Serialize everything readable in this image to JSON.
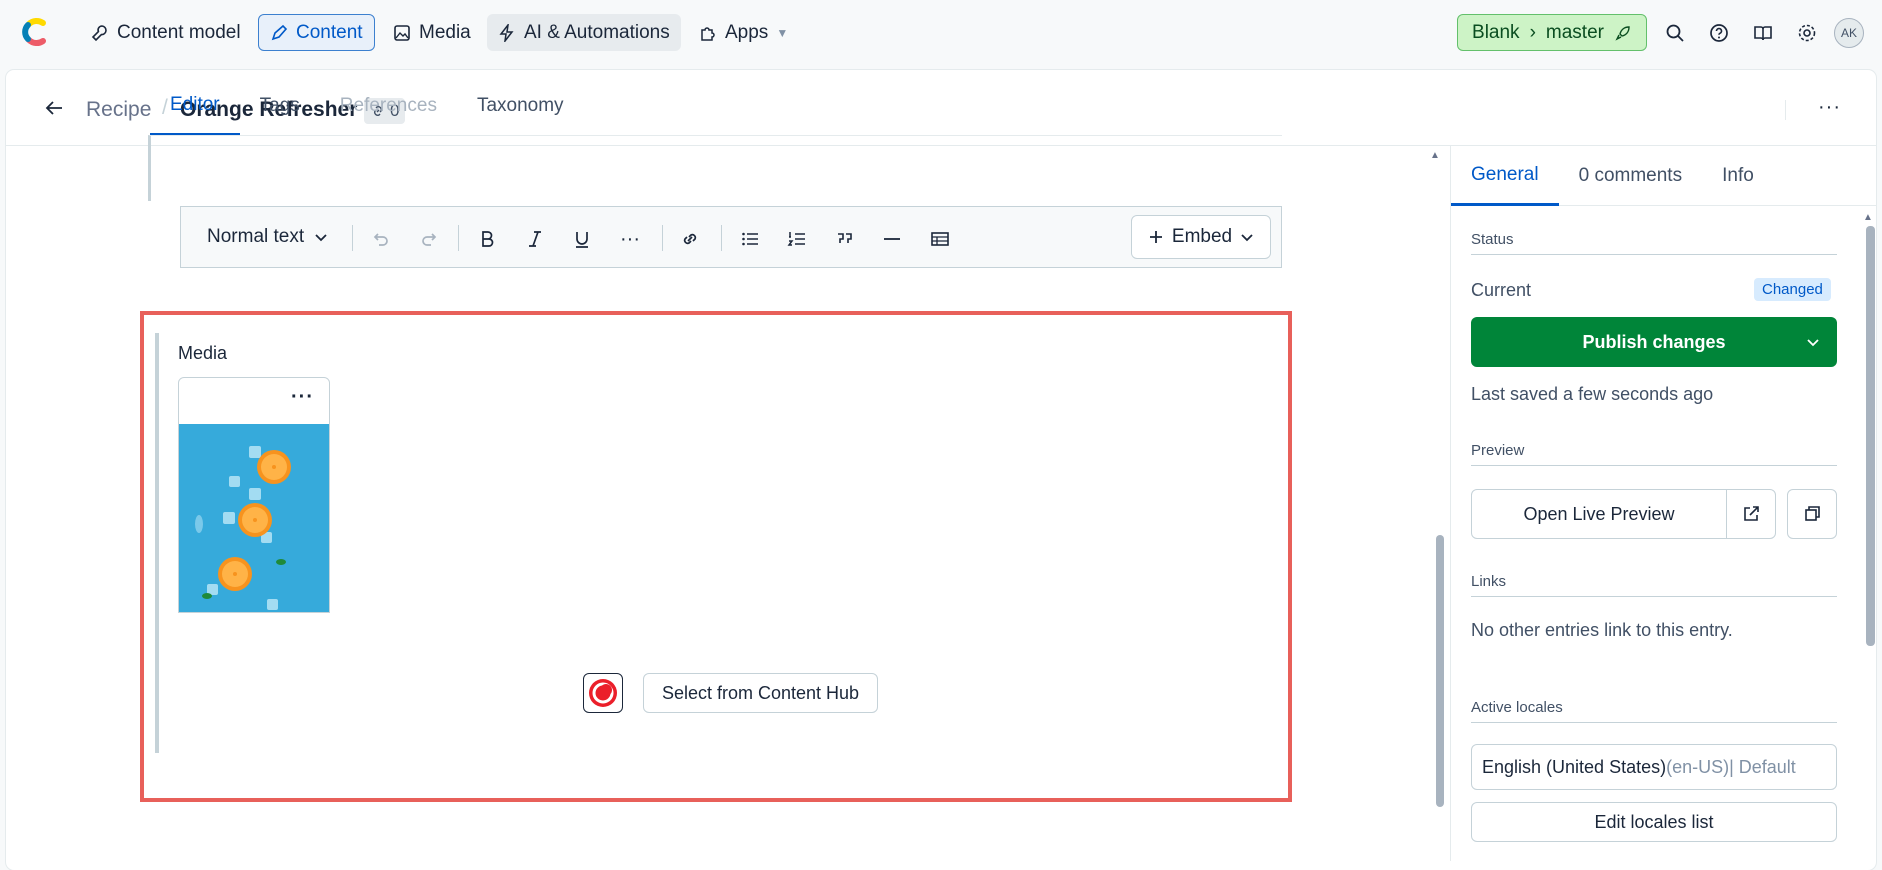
{
  "nav": {
    "content_model": "Content model",
    "content": "Content",
    "media": "Media",
    "ai": "AI & Automations",
    "apps": "Apps",
    "env_space": "Blank",
    "env_branch": "master",
    "avatar": "AK"
  },
  "header": {
    "crumb_type": "Recipe",
    "title": "Orange Refresher",
    "link_count": "0"
  },
  "tabs": [
    "Editor",
    "Tags",
    "References",
    "Taxonomy"
  ],
  "toolbar": {
    "text_style": "Normal text",
    "embed": "Embed"
  },
  "media": {
    "label": "Media",
    "asset_menu": "···",
    "hub_button": "Select from Content Hub"
  },
  "sidebar": {
    "tabs": [
      "General",
      "0 comments",
      "Info"
    ],
    "status_title": "Status",
    "current_label": "Current",
    "changed_badge": "Changed",
    "publish_button": "Publish changes",
    "last_saved": "Last saved a few seconds ago",
    "preview_title": "Preview",
    "open_preview": "Open Live Preview",
    "links_title": "Links",
    "links_empty": "No other entries link to this entry.",
    "locales_title": "Active locales",
    "locale_name": "English (United States)",
    "locale_code": " (en-US)| Default",
    "edit_locales": "Edit locales list"
  },
  "colors": {
    "accent": "#0059c8",
    "publish": "#008539",
    "highlight": "#e8605a"
  }
}
